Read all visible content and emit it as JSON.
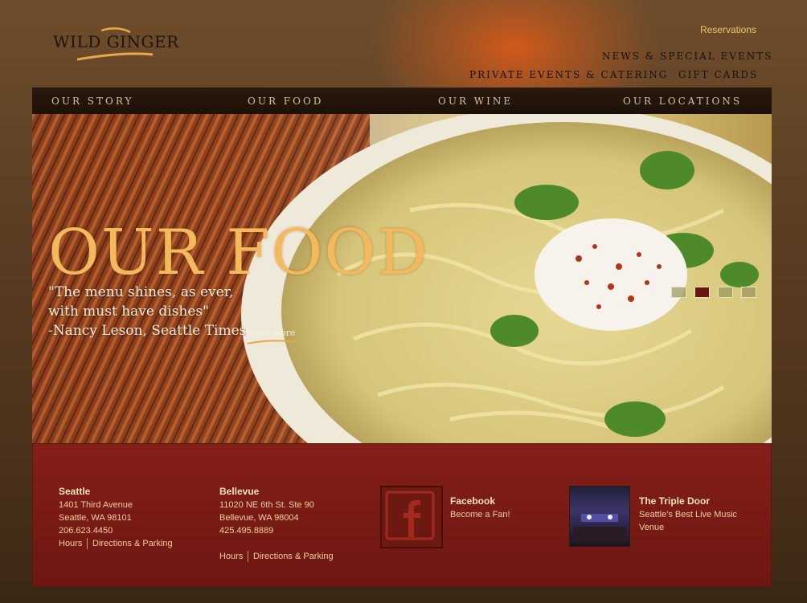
{
  "brand": {
    "logo_text": "WILD GINGER"
  },
  "header": {
    "reservations": "Reservations",
    "links": {
      "news": "NEWS & SPECIAL EVENTS",
      "private": "PRIVATE EVENTS & CATERING",
      "gift": "GIFT CARDS"
    }
  },
  "nav": {
    "items": [
      {
        "label": "OUR STORY"
      },
      {
        "label": "OUR FOOD"
      },
      {
        "label": "OUR WINE"
      },
      {
        "label": "OUR LOCATIONS"
      }
    ]
  },
  "hero": {
    "title": "OUR FOOD",
    "quote_lines": [
      "\"The menu shines, as ever,",
      "with must have dishes\"",
      "-Nancy Leson, Seattle Times"
    ],
    "learn_more": "learn more",
    "slides_count": 4,
    "active_slide": 2
  },
  "footer": {
    "seattle": {
      "name": "Seattle",
      "address1": "1401 Third Avenue",
      "address2": "Seattle, WA 98101",
      "phone": "206.623.4450",
      "hours": "Hours",
      "directions": "Directions & Parking"
    },
    "bellevue": {
      "name": "Bellevue",
      "address1": "11020 NE 6th St. Ste 90",
      "address2": "Bellevue, WA 98004",
      "phone": "425.495.8889",
      "hours": "Hours",
      "directions": "Directions & Parking"
    },
    "facebook": {
      "title": "Facebook",
      "subtitle": "Become a Fan!"
    },
    "triple_door": {
      "title": "The Triple Door",
      "subtitle": "Seattle's Best Live Music Venue"
    }
  },
  "colors": {
    "accent": "#f4b95c",
    "footer_bg": "#841e18",
    "nav_bg": "#1c1008",
    "facebook_red": "#7a1a14"
  }
}
